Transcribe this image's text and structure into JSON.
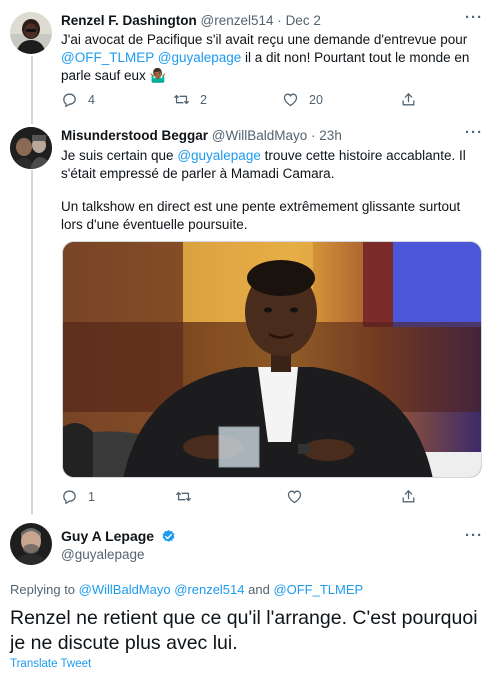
{
  "tweet1": {
    "name": "Renzel F. Dashington",
    "handle": "@renzel514",
    "sep": "·",
    "time": "Dec 2",
    "text_part1": "J'ai avocat de Pacifique s'il avait reçu une demande d'entrevue pour ",
    "mention1": "@OFF_TLMEP",
    "mention2": "@guyalepage",
    "text_part2": " il a dit non! Pourtant tout le monde en parle sauf eux 🤷🏾‍♂️",
    "replies": "4",
    "retweets": "2",
    "likes": "20"
  },
  "tweet2": {
    "name": "Misunderstood Beggar",
    "handle": "@WillBaldMayo",
    "sep": "·",
    "time": "23h",
    "text_part1": "Je suis certain que ",
    "mention": "@guyalepage",
    "text_part2": " trouve cette histoire accablante. Il s'était empressé de parler à Mamadi Camara.",
    "text_part3": "Un talkshow en direct est une pente extrêmement glissante surtout lors d'une éventuelle poursuite.",
    "replies": "1"
  },
  "main": {
    "name": "Guy A Lepage",
    "handle": "@guyalepage",
    "replying_prefix": "Replying to ",
    "replying_users": "@WillBaldMayo @renzel514",
    "replying_and": " and ",
    "replying_last": "@OFF_TLMEP",
    "text": "Renzel ne retient que ce qu'il l'arrange. C'est pourquoi je ne discute plus avec lui.",
    "translate": "Translate Tweet"
  },
  "more_label": "···",
  "colors": {
    "accent": "#1d9bf0",
    "secondary_text": "#536471",
    "verified": "#1d9bf0"
  },
  "icons": [
    "reply-icon",
    "retweet-icon",
    "like-icon",
    "share-icon",
    "more-icon",
    "verified-icon"
  ]
}
